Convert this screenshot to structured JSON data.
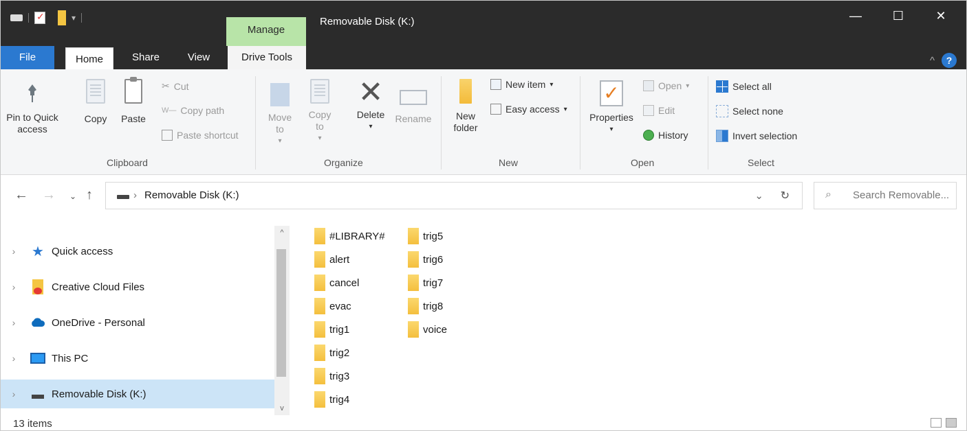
{
  "window": {
    "title": "Removable Disk (K:)",
    "context_tab": "Manage",
    "controls": {
      "minimize": "—",
      "maximize": "☐",
      "close": "✕"
    }
  },
  "ribbon_tabs": [
    "File",
    "Home",
    "Share",
    "View",
    "Drive Tools"
  ],
  "ribbon": {
    "clipboard": {
      "label": "Clipboard",
      "pin": "Pin to Quick access",
      "copy": "Copy",
      "paste": "Paste",
      "cut": "Cut",
      "copy_path": "Copy path",
      "paste_shortcut": "Paste shortcut"
    },
    "organize": {
      "label": "Organize",
      "move_to": "Move to",
      "copy_to": "Copy to",
      "delete": "Delete",
      "rename": "Rename"
    },
    "new": {
      "label": "New",
      "new_folder": "New folder",
      "new_item": "New item",
      "easy_access": "Easy access"
    },
    "open": {
      "label": "Open",
      "properties": "Properties",
      "open": "Open",
      "edit": "Edit",
      "history": "History"
    },
    "select": {
      "label": "Select",
      "select_all": "Select all",
      "select_none": "Select none",
      "invert": "Invert selection"
    }
  },
  "address": {
    "path": "Removable Disk (K:)",
    "search_placeholder": "Search Removable..."
  },
  "nav_pane": [
    {
      "label": "Quick access",
      "icon": "star-icon"
    },
    {
      "label": "Creative Cloud Files",
      "icon": "creative-cloud-folder-icon"
    },
    {
      "label": "OneDrive - Personal",
      "icon": "cloud-icon"
    },
    {
      "label": "This PC",
      "icon": "monitor-icon"
    },
    {
      "label": "Removable Disk (K:)",
      "icon": "drive-icon",
      "selected": true
    }
  ],
  "files_col1": [
    "#LIBRARY#",
    "alert",
    "cancel",
    "evac",
    "trig1",
    "trig2",
    "trig3",
    "trig4"
  ],
  "files_col2": [
    "trig5",
    "trig6",
    "trig7",
    "trig8",
    "voice"
  ],
  "status": {
    "count": "13 items"
  },
  "colors": {
    "accent": "#2b79d0",
    "manage_tab": "#b8e4a8",
    "selection": "#cce4f7",
    "titlebar": "#2b2b2b"
  }
}
